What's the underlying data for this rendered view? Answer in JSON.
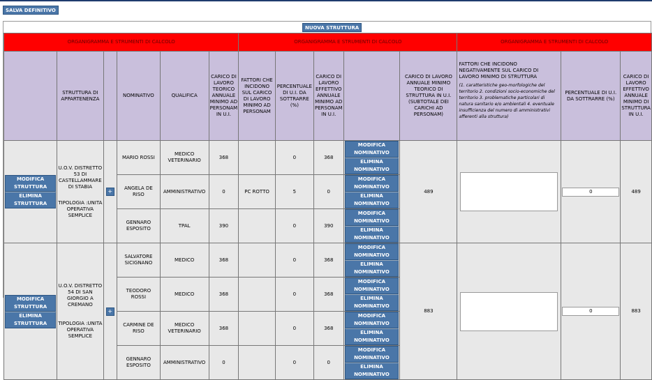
{
  "toolbar": {
    "save_label": "SALVA DEFINITIVO"
  },
  "new_structure_label": "NUOVA STRUTTURA",
  "section_titles": [
    "ORGANIGRAMMA E STRUMENTI DI CALCOLO",
    "ORGANIGRAMMA E STRUMENTI DI CALCOLO",
    "ORGANIGRAMMA E STRUMENTI DI CALCOLO"
  ],
  "headers": {
    "struttura": "STRUTTURA DI APPARTENENZA",
    "nominativo": "NOMINATIVO",
    "qualifica": "QUALIFICA",
    "carico_teorico": "CARICO DI LAVORO TEORICO ANNUALE MINIMO AD PERSONAM IN U.I.",
    "fattori": "FATTORI CHE INCIDONO SUL CARICO DI LAVORO MINIMO AD PERSONAM",
    "percentuale": "PERCENTUALE DI U.I. DA SOTTRARRE (%)",
    "carico_effettivo": "CARICO DI LAVORO EFFETTIVO ANNUALE MINIMO AD PERSONAM IN U.I.",
    "carico_struttura": "CARICO DI LAVORO ANNUALE MINIMO TEORICO DI STRUTTURA IN U.I. (SUBTOTALE DEI CARICHI AD PERSONAM)",
    "fattori_struttura_title": "FATTORI CHE INCIDONO NEGATIVAMENTE SUL CARICO DI LAVORO MINIMO DI STRUTTURA",
    "fattori_struttura_note": "(1. caratteristiche geo-morfologiche del territorio 2. condizioni socio-economiche del territorio 3. problematiche particolari di natura sanitario e/o ambientali 4. eventuale insufficienza del numero di amministrativi afferenti alla struttura)",
    "percentuale_struttura": "PERCENTUALE DI U.I. DA SOTTRARRE (%)",
    "carico_effettivo_struttura": "CARICO DI LAVORO EFFETTIVO ANNUALE MINIMO DI STRUTTURA IN U.I."
  },
  "actions": {
    "modifica_struttura": "MODIFICA STRUTTURA",
    "elimina_struttura": "ELIMINA STRUTTURA",
    "modifica_nominativo": "MODIFICA NOMINATIVO",
    "elimina_nominativo": "ELIMINA NOMINATIVO",
    "plus": "+"
  },
  "structures": [
    {
      "name": "U.O.V. DISTRETTO 53 DI CASTELLAMMARE DI STABIA",
      "tipologia": "TIPOLOGIA :UNITA OPERATIVA SEMPLICE",
      "subtotal": "489",
      "percent_value": "0",
      "effective": "489",
      "people": [
        {
          "nome": "MARIO ROSSI",
          "qualifica": "MEDICO VETERINARIO",
          "teorico": "368",
          "fattori": "",
          "perc": "0",
          "effettivo": "368"
        },
        {
          "nome": "ANGELA DE RISO",
          "qualifica": "AMMINISTRATIVO",
          "teorico": "0",
          "fattori": "PC ROTTO",
          "perc": "5",
          "effettivo": "0"
        },
        {
          "nome": "GENNARO ESPOSITO",
          "qualifica": "TPAL",
          "teorico": "390",
          "fattori": "",
          "perc": "0",
          "effettivo": "390"
        }
      ]
    },
    {
      "name": "U.O.V. DISTRETTO 54 DI SAN GIORGIO A CREMANO",
      "tipologia": "TIPOLOGIA :UNITA OPERATIVA SEMPLICE",
      "subtotal": "883",
      "percent_value": "0",
      "effective": "883",
      "people": [
        {
          "nome": "SALVATORE SICIGNANO",
          "qualifica": "MEDICO",
          "teorico": "368",
          "fattori": "",
          "perc": "0",
          "effettivo": "368"
        },
        {
          "nome": "TEODORO ROSSI",
          "qualifica": "MEDICO",
          "teorico": "368",
          "fattori": "",
          "perc": "0",
          "effettivo": "368"
        },
        {
          "nome": "CARMINE DE RISO",
          "qualifica": "MEDICO VETERINARIO",
          "teorico": "368",
          "fattori": "",
          "perc": "0",
          "effettivo": "368"
        },
        {
          "nome": "GENNARO ESPOSITO",
          "qualifica": "AMMINISTRATIVO",
          "teorico": "0",
          "fattori": "",
          "perc": "0",
          "effettivo": "0"
        }
      ]
    }
  ]
}
